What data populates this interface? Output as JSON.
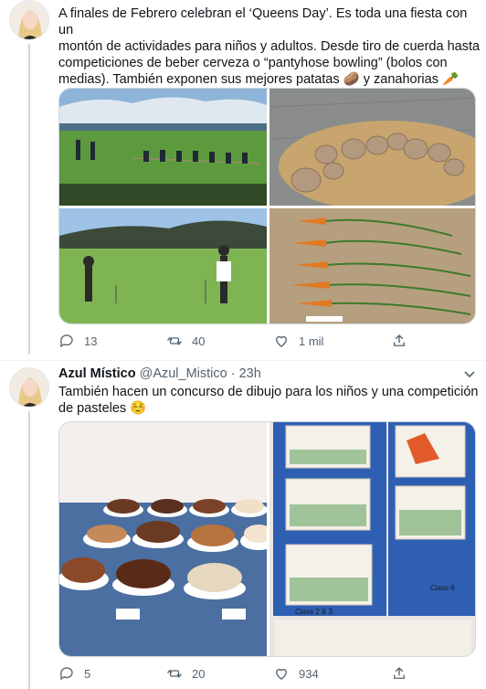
{
  "tweet1": {
    "text_line1": "A finales de Febrero celebran el ‘Queens Day’. Es toda una fiesta con un",
    "text_line2": "montón de actividades para niños y adultos. Desde tiro de cuerda hasta",
    "text_line3": "competiciones de beber cerveza o “pantyhose bowling” (bolos con",
    "text_line4": "medias). También exponen sus mejores patatas",
    "text_line4_mid": "y zanahorias",
    "emoji_1": "🥔",
    "emoji_2": "🥕",
    "replies": "13",
    "retweets": "40",
    "likes": "1 mil"
  },
  "tweet2": {
    "name": "Azul Místico",
    "handle": "@Azul_Mistico",
    "separator": " · ",
    "time": "23h",
    "text_line1": "También hacen un concurso de dibujo para los niños y una competición",
    "text_line2": "de pasteles",
    "emoji": "☺️",
    "replies": "5",
    "retweets": "20",
    "likes": "934",
    "photo_label_1": "Class 6",
    "photo_label_2": "Class 2 & 3"
  },
  "colors": {
    "text": "#0f1419",
    "secondary": "#536471",
    "border": "#cfd9de"
  },
  "icons": {
    "reply": "reply-icon",
    "retweet": "retweet-icon",
    "like": "heart-icon",
    "share": "share-icon",
    "more": "chevron-down-icon"
  }
}
